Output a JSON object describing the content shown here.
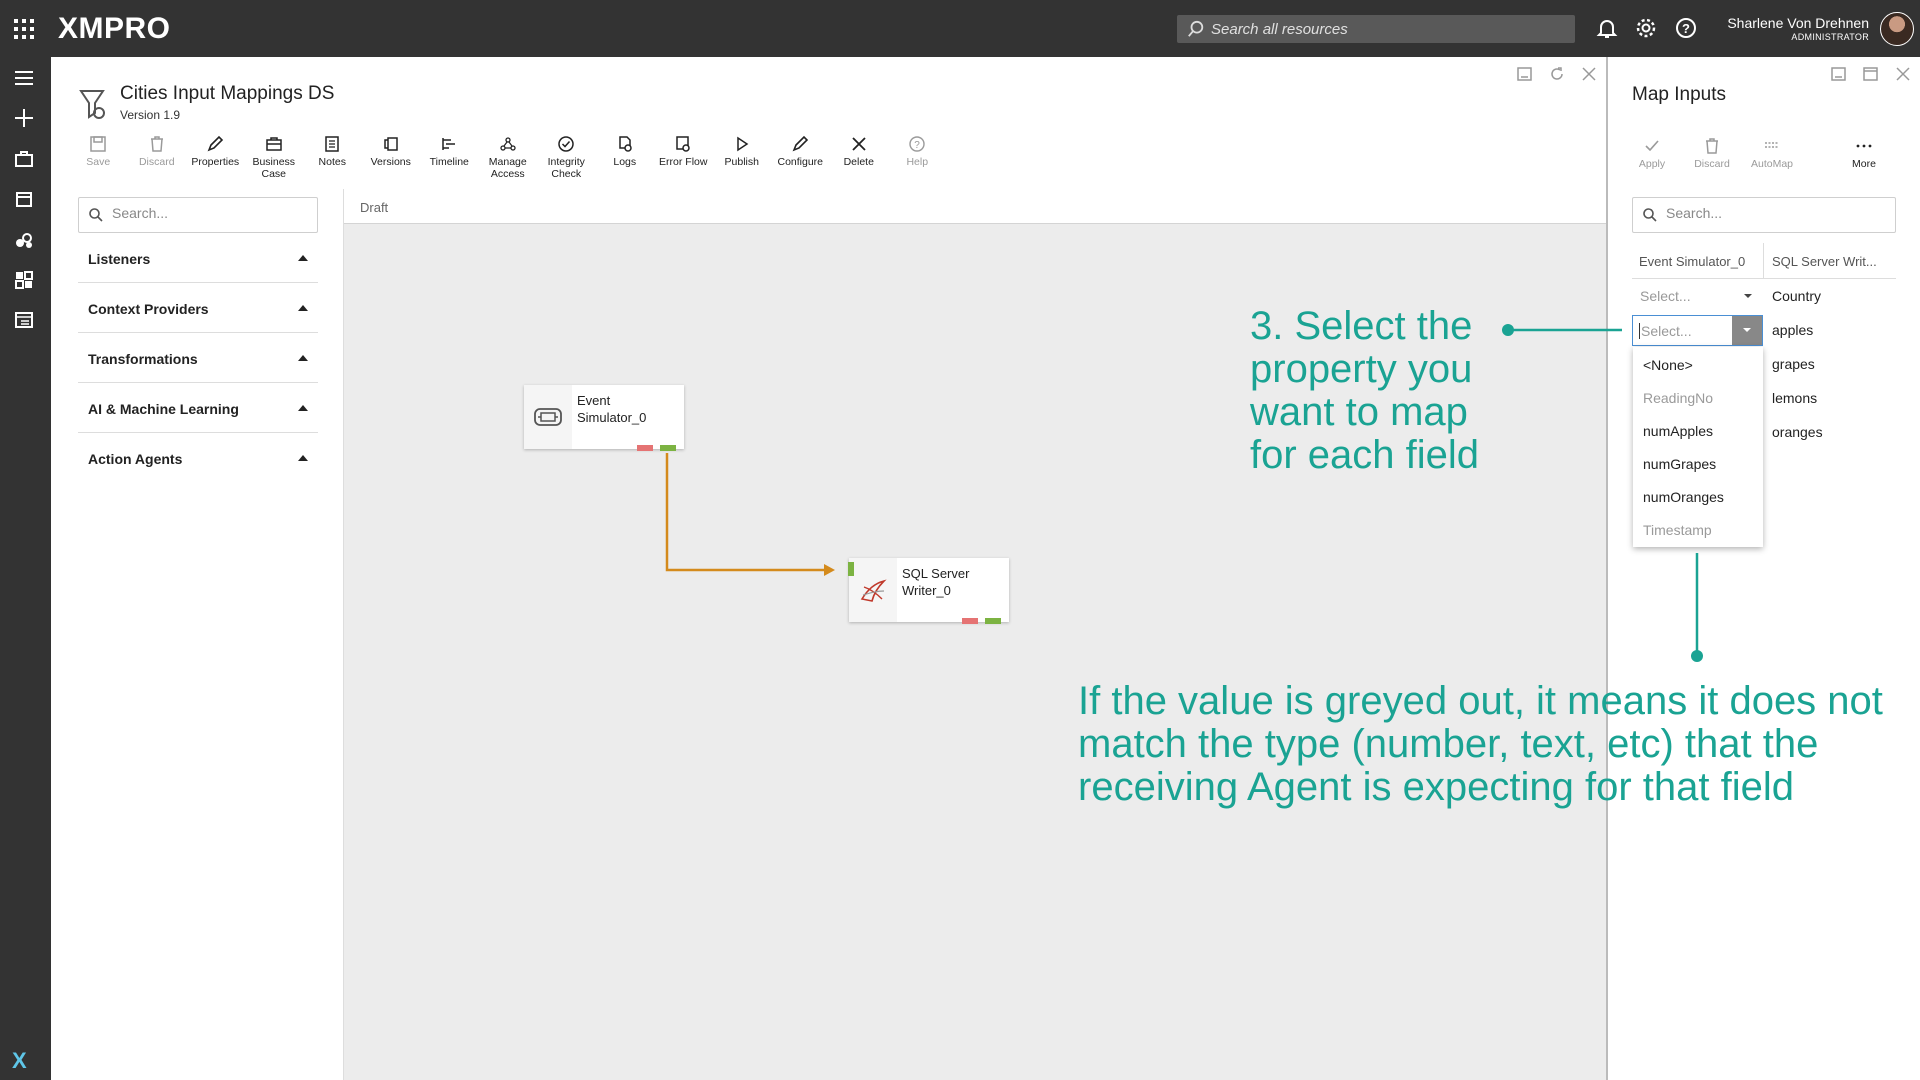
{
  "app": {
    "brand": "XMPRO",
    "search_placeholder": "Search all resources",
    "user_name": "Sharlene Von Drehnen",
    "user_role": "ADMINISTRATOR"
  },
  "datastream": {
    "title": "Cities Input Mappings DS",
    "version": "Version 1.9"
  },
  "toolbar": [
    {
      "label": "Save",
      "icon": "save-icon",
      "disabled": true
    },
    {
      "label": "Discard",
      "icon": "trash-icon",
      "disabled": true
    },
    {
      "label": "Properties",
      "icon": "pencil-icon",
      "disabled": false
    },
    {
      "label": "Business Case",
      "icon": "briefcase-icon",
      "disabled": false
    },
    {
      "label": "Notes",
      "icon": "notes-icon",
      "disabled": false
    },
    {
      "label": "Versions",
      "icon": "versions-icon",
      "disabled": false
    },
    {
      "label": "Timeline",
      "icon": "timeline-icon",
      "disabled": false
    },
    {
      "label": "Manage Access",
      "icon": "access-icon",
      "disabled": false
    },
    {
      "label": "Integrity Check",
      "icon": "check-circle-icon",
      "disabled": false
    },
    {
      "label": "Logs",
      "icon": "logs-icon",
      "disabled": false
    },
    {
      "label": "Error Flow",
      "icon": "error-flow-icon",
      "disabled": false
    },
    {
      "label": "Publish",
      "icon": "play-icon",
      "disabled": false
    },
    {
      "label": "Configure",
      "icon": "pencil-icon",
      "disabled": false
    },
    {
      "label": "Delete",
      "icon": "close-icon",
      "disabled": false
    },
    {
      "label": "Help",
      "icon": "help-icon",
      "disabled": true
    }
  ],
  "left_panel": {
    "search_placeholder": "Search...",
    "categories": [
      {
        "label": "Listeners"
      },
      {
        "label": "Context Providers"
      },
      {
        "label": "Transformations"
      },
      {
        "label": "AI & Machine Learning"
      },
      {
        "label": "Action Agents"
      }
    ]
  },
  "canvas": {
    "tab": "Draft",
    "nodes": [
      {
        "label": "Event Simulator_0",
        "icon": "event-simulator-icon"
      },
      {
        "label": "SQL Server Writer_0",
        "icon": "sql-server-icon"
      }
    ]
  },
  "map_inputs": {
    "title": "Map Inputs",
    "tools": [
      {
        "label": "Apply",
        "icon": "check-icon"
      },
      {
        "label": "Discard",
        "icon": "trash-icon"
      },
      {
        "label": "AutoMap",
        "icon": "automap-icon"
      },
      {
        "label": "More",
        "icon": "more-icon"
      }
    ],
    "search_placeholder": "Search...",
    "col_source": "Event Simulator_0",
    "col_target": "SQL Server Writ...",
    "select_placeholder": "Select...",
    "rows": [
      {
        "field": "Country"
      },
      {
        "field": "apples"
      },
      {
        "field": "grapes"
      },
      {
        "field": "lemons"
      },
      {
        "field": "oranges"
      }
    ],
    "dropdown_options": [
      {
        "label": "<None>",
        "greyed": false
      },
      {
        "label": "ReadingNo",
        "greyed": true
      },
      {
        "label": "numApples",
        "greyed": false
      },
      {
        "label": "numGrapes",
        "greyed": false
      },
      {
        "label": "numOranges",
        "greyed": false
      },
      {
        "label": "Timestamp",
        "greyed": true
      }
    ]
  },
  "annotations": {
    "step3": [
      "3. Select the",
      "property you",
      "want to map",
      "for each field"
    ],
    "note": [
      "If the value is greyed out, it means it does not",
      "match the type (number, text, etc) that the",
      "receiving Agent is expecting for that field"
    ],
    "color": "#1aa393"
  }
}
